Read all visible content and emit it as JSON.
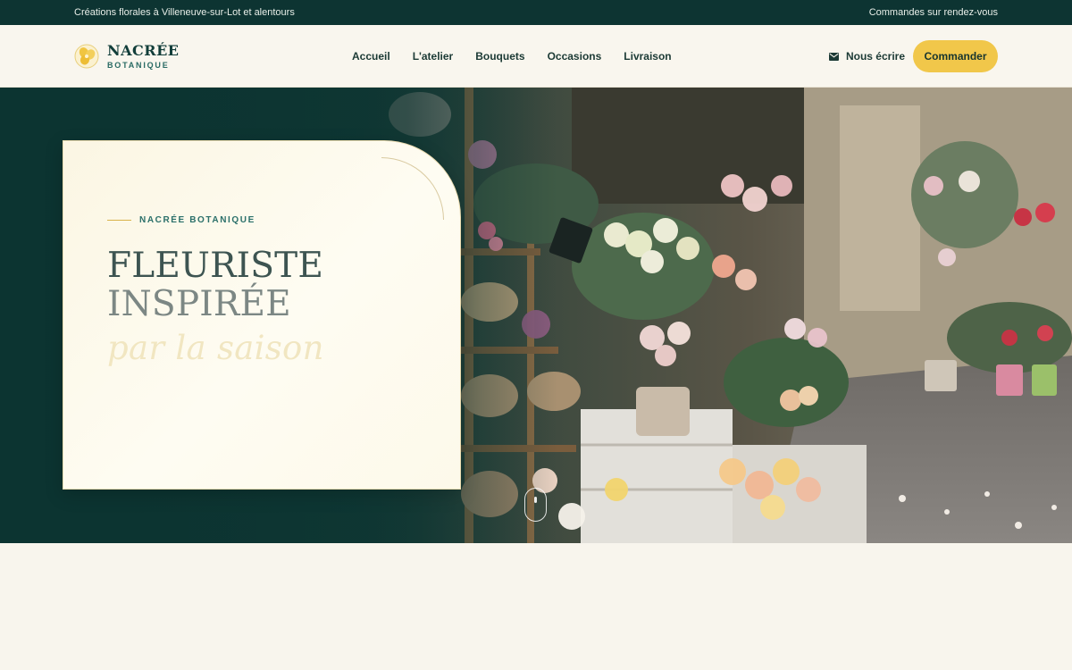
{
  "topbar": {
    "left_text": "Créations florales à Villeneuve-sur-Lot et alentours",
    "right_text": "Commandes sur rendez-vous"
  },
  "brand": {
    "name": "NACRÉE",
    "tagline": "BOTANIQUE",
    "logo_icon": "flower-logo-icon"
  },
  "nav": {
    "items": [
      {
        "label": "Accueil"
      },
      {
        "label": "L'atelier"
      },
      {
        "label": "Bouquets"
      },
      {
        "label": "Occasions"
      },
      {
        "label": "Livraison"
      }
    ]
  },
  "header": {
    "contact_label": "Nous écrire",
    "contact_icon": "mail-icon",
    "order_label": "Commander"
  },
  "hero": {
    "eyebrow": "NACRÉE BOTANIQUE",
    "title_line1": "FLEURISTE",
    "title_line2": "INSPIRÉE",
    "title_line3": "par la saison",
    "scroll_icon": "scroll-mouse-icon"
  },
  "colors": {
    "dark_green": "#0d3432",
    "accent_yellow": "#f1c74a",
    "cream": "#f8f5ed",
    "teal_text": "#2b706a"
  }
}
